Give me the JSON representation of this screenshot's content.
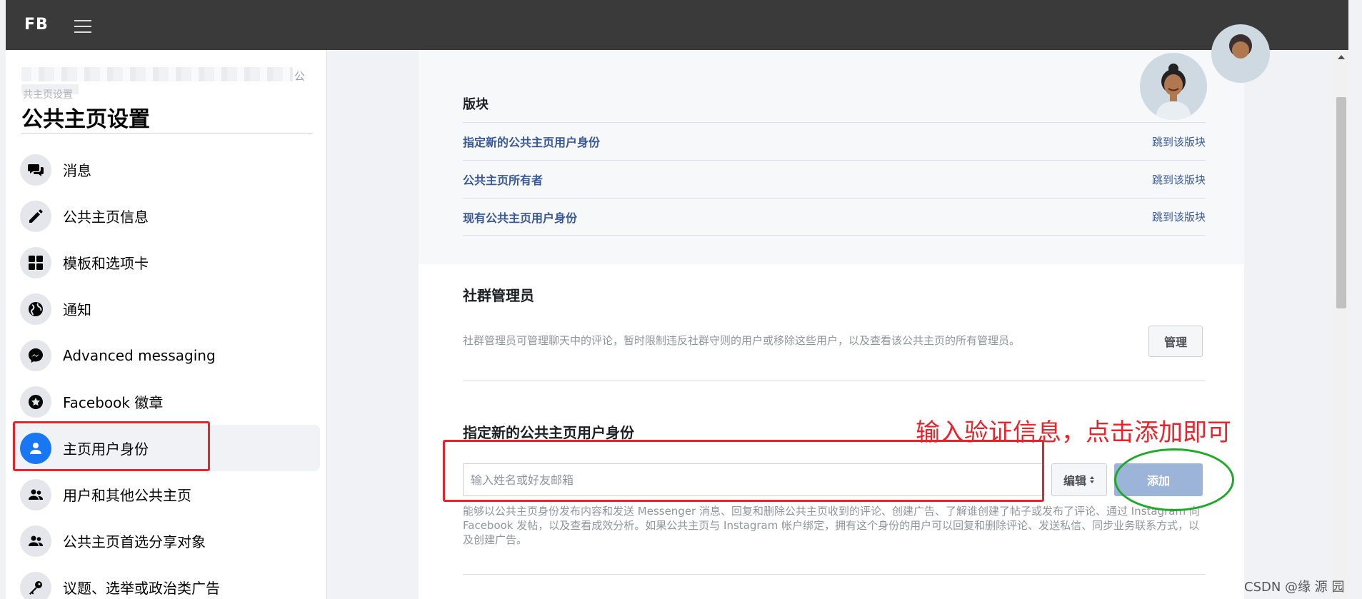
{
  "topbar": {
    "logo": "FB"
  },
  "sidebar": {
    "breadcrumb_tail": "公",
    "breadcrumb_sub": "共主页设置",
    "title": "公共主页设置",
    "items": [
      {
        "label": "消息",
        "icon": "chat-bubbles-icon"
      },
      {
        "label": "公共主页信息",
        "icon": "pencil-icon"
      },
      {
        "label": "模板和选项卡",
        "icon": "grid-icon"
      },
      {
        "label": "通知",
        "icon": "globe-icon"
      },
      {
        "label": "Advanced messaging",
        "icon": "messenger-icon"
      },
      {
        "label": "Facebook 徽章",
        "icon": "star-badge-icon"
      },
      {
        "label": "主页用户身份",
        "icon": "person-icon",
        "active": true
      },
      {
        "label": "用户和其他公共主页",
        "icon": "people-icon"
      },
      {
        "label": "公共主页首选分享对象",
        "icon": "people-icon"
      },
      {
        "label": "议题、选举或政治类广告",
        "icon": "key-icon"
      }
    ]
  },
  "main": {
    "blocks_title": "版块",
    "blocks": [
      {
        "label": "指定新的公共主页用户身份",
        "jump": "跳到该版块"
      },
      {
        "label": "公共主页所有者",
        "jump": "跳到该版块"
      },
      {
        "label": "现有公共主页用户身份",
        "jump": "跳到该版块"
      }
    ],
    "moderator": {
      "title": "社群管理员",
      "description": "社群管理员可管理聊天中的评论，暂时限制违反社群守则的用户或移除这些用户，以及查看该公共主页的所有管理员。",
      "button": "管理"
    },
    "assign": {
      "title": "指定新的公共主页用户身份",
      "placeholder": "输入姓名或好友邮箱",
      "edit_label": "编辑",
      "add_label": "添加",
      "description": "能够以公共主页身份发布内容和发送 Messenger 消息、回复和删除公共主页收到的评论、创建广告、了解谁创建了帖子或发布了评论、通过 Instagram 向 Facebook 发帖，以及查看成效分析。如果公共主页与 Instagram 帐户绑定，拥有这个身份的用户可以回复和删除评论、发送私信、同步业务联系方式，以及创建广告。"
    }
  },
  "annotation": {
    "note": "输入验证信息，点击添加即可"
  },
  "watermark": "CSDN @缘 源 园",
  "colors": {
    "accent": "#1877f2",
    "link": "#385898",
    "annotation_red": "#e5242b",
    "annotation_green": "#1fa82a",
    "topbar": "#3a3a3a"
  }
}
